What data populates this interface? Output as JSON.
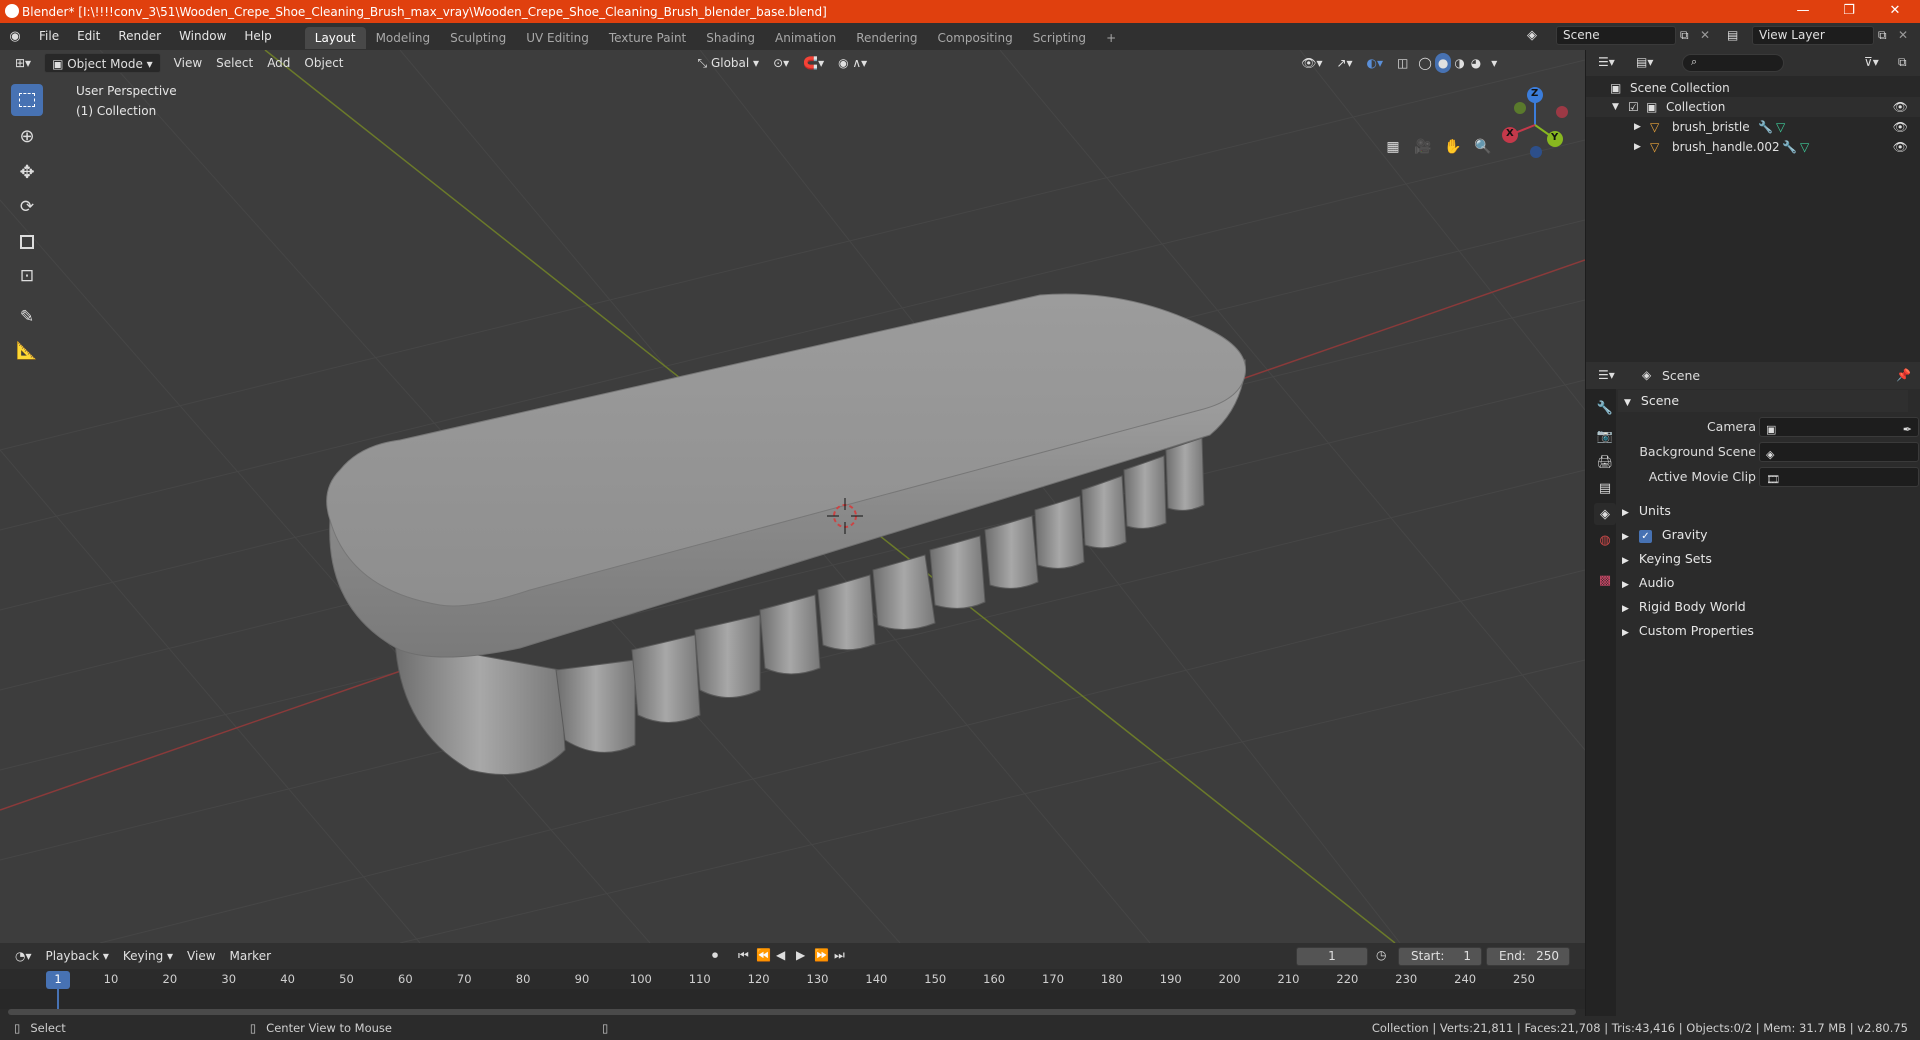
{
  "window": {
    "title": "Blender* [I:\\!!!!conv_3\\51\\Wooden_Crepe_Shoe_Cleaning_Brush_max_vray\\Wooden_Crepe_Shoe_Cleaning_Brush_blender_base.blend]",
    "minimize": "—",
    "maximize": "❐",
    "close": "✕"
  },
  "menu": [
    "File",
    "Edit",
    "Render",
    "Window",
    "Help"
  ],
  "workspaces": [
    "Layout",
    "Modeling",
    "Sculpting",
    "UV Editing",
    "Texture Paint",
    "Shading",
    "Animation",
    "Rendering",
    "Compositing",
    "Scripting"
  ],
  "workspace_add": "+",
  "scene_selector": "Scene",
  "view_layer": "View Layer",
  "viewport": {
    "mode": "Object Mode",
    "menus": [
      "View",
      "Select",
      "Add",
      "Object"
    ],
    "orientation": "Global",
    "overlay_title": "User Perspective",
    "overlay_collection": "(1) Collection",
    "gizmo": {
      "x": "X",
      "y": "Y",
      "z": "Z"
    }
  },
  "outliner": {
    "search_placeholder": "",
    "scene_collection": "Scene Collection",
    "collection": "Collection",
    "objects": [
      "brush_bristle",
      "brush_handle.002"
    ]
  },
  "properties": {
    "header": "Scene",
    "section": "Scene",
    "fields": [
      {
        "label": "Camera",
        "value": ""
      },
      {
        "label": "Background Scene",
        "value": ""
      },
      {
        "label": "Active Movie Clip",
        "value": ""
      }
    ],
    "panels": [
      "Units",
      "Gravity",
      "Keying Sets",
      "Audio",
      "Rigid Body World",
      "Custom Properties"
    ],
    "gravity_checked": true
  },
  "timeline": {
    "menus": [
      "Playback",
      "Keying",
      "View",
      "Marker"
    ],
    "current_frame": "1",
    "start_label": "Start:",
    "start": "1",
    "end_label": "End:",
    "end": "250",
    "ruler": [
      "1",
      "10",
      "20",
      "30",
      "40",
      "50",
      "60",
      "70",
      "80",
      "90",
      "100",
      "110",
      "120",
      "130",
      "140",
      "150",
      "160",
      "170",
      "180",
      "190",
      "200",
      "210",
      "220",
      "230",
      "240",
      "250"
    ]
  },
  "status": {
    "left": "Select",
    "middle": "Center View to Mouse",
    "right": "Collection | Verts:21,811 | Faces:21,708 | Tris:43,416 | Objects:0/2 | Mem: 31.7 MB | v2.80.75"
  },
  "colors": {
    "accent": "#4772b3",
    "titlebar": "#e0400e",
    "x_axis": "#c4394a",
    "y_axis": "#88b820",
    "z_axis": "#3b7ddb"
  }
}
